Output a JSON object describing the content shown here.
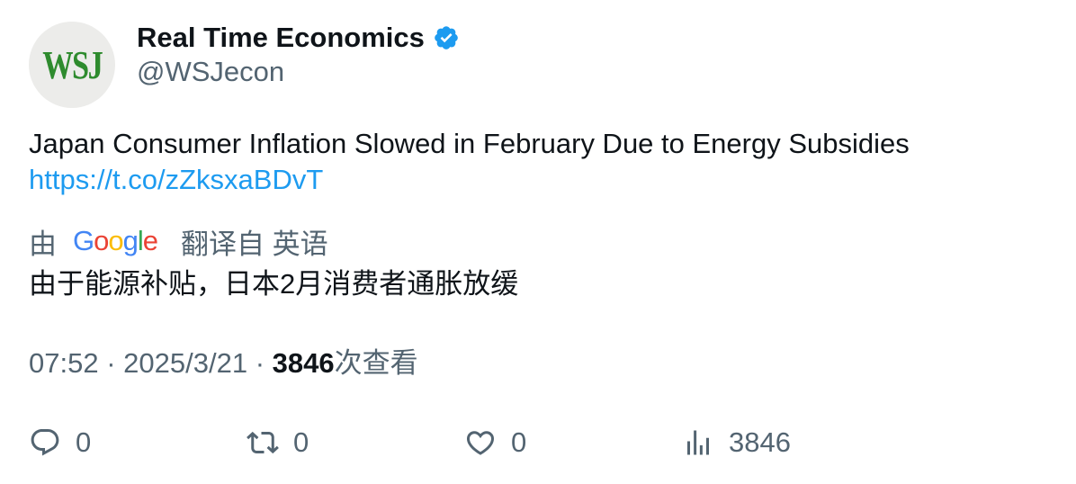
{
  "account": {
    "avatar_text": "WSJ",
    "display_name": "Real Time Economics",
    "handle": "@WSJecon",
    "verified_icon": "verified-badge-icon",
    "avatar_color": "#2e8b2e",
    "verified_color": "#1d9bf0"
  },
  "tweet": {
    "text": "Japan Consumer Inflation Slowed in February Due to Energy Subsidies",
    "link": "https://t.co/zZksxaBDvT"
  },
  "translation": {
    "prefix": "由",
    "provider_logo_text": "Google",
    "suffix": "翻译自 英语",
    "text": "由于能源补贴，日本2月消费者通胀放缓"
  },
  "meta": {
    "time": "07:52",
    "separator": "·",
    "date": "2025/3/21",
    "views_count": "3846",
    "views_label": "次查看"
  },
  "actions": {
    "reply": {
      "icon": "reply-icon",
      "count": "0"
    },
    "retweet": {
      "icon": "retweet-icon",
      "count": "0"
    },
    "like": {
      "icon": "heart-icon",
      "count": "0"
    },
    "views": {
      "icon": "analytics-icon",
      "count": "3846"
    }
  }
}
